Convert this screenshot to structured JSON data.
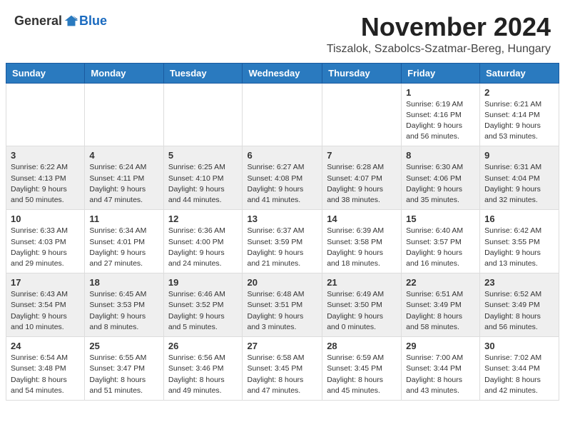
{
  "header": {
    "logo_general": "General",
    "logo_blue": "Blue",
    "month_title": "November 2024",
    "location": "Tiszalok, Szabolcs-Szatmar-Bereg, Hungary"
  },
  "days_of_week": [
    "Sunday",
    "Monday",
    "Tuesday",
    "Wednesday",
    "Thursday",
    "Friday",
    "Saturday"
  ],
  "weeks": [
    [
      {
        "day": "",
        "detail": ""
      },
      {
        "day": "",
        "detail": ""
      },
      {
        "day": "",
        "detail": ""
      },
      {
        "day": "",
        "detail": ""
      },
      {
        "day": "",
        "detail": ""
      },
      {
        "day": "1",
        "detail": "Sunrise: 6:19 AM\nSunset: 4:16 PM\nDaylight: 9 hours and 56 minutes."
      },
      {
        "day": "2",
        "detail": "Sunrise: 6:21 AM\nSunset: 4:14 PM\nDaylight: 9 hours and 53 minutes."
      }
    ],
    [
      {
        "day": "3",
        "detail": "Sunrise: 6:22 AM\nSunset: 4:13 PM\nDaylight: 9 hours and 50 minutes."
      },
      {
        "day": "4",
        "detail": "Sunrise: 6:24 AM\nSunset: 4:11 PM\nDaylight: 9 hours and 47 minutes."
      },
      {
        "day": "5",
        "detail": "Sunrise: 6:25 AM\nSunset: 4:10 PM\nDaylight: 9 hours and 44 minutes."
      },
      {
        "day": "6",
        "detail": "Sunrise: 6:27 AM\nSunset: 4:08 PM\nDaylight: 9 hours and 41 minutes."
      },
      {
        "day": "7",
        "detail": "Sunrise: 6:28 AM\nSunset: 4:07 PM\nDaylight: 9 hours and 38 minutes."
      },
      {
        "day": "8",
        "detail": "Sunrise: 6:30 AM\nSunset: 4:06 PM\nDaylight: 9 hours and 35 minutes."
      },
      {
        "day": "9",
        "detail": "Sunrise: 6:31 AM\nSunset: 4:04 PM\nDaylight: 9 hours and 32 minutes."
      }
    ],
    [
      {
        "day": "10",
        "detail": "Sunrise: 6:33 AM\nSunset: 4:03 PM\nDaylight: 9 hours and 29 minutes."
      },
      {
        "day": "11",
        "detail": "Sunrise: 6:34 AM\nSunset: 4:01 PM\nDaylight: 9 hours and 27 minutes."
      },
      {
        "day": "12",
        "detail": "Sunrise: 6:36 AM\nSunset: 4:00 PM\nDaylight: 9 hours and 24 minutes."
      },
      {
        "day": "13",
        "detail": "Sunrise: 6:37 AM\nSunset: 3:59 PM\nDaylight: 9 hours and 21 minutes."
      },
      {
        "day": "14",
        "detail": "Sunrise: 6:39 AM\nSunset: 3:58 PM\nDaylight: 9 hours and 18 minutes."
      },
      {
        "day": "15",
        "detail": "Sunrise: 6:40 AM\nSunset: 3:57 PM\nDaylight: 9 hours and 16 minutes."
      },
      {
        "day": "16",
        "detail": "Sunrise: 6:42 AM\nSunset: 3:55 PM\nDaylight: 9 hours and 13 minutes."
      }
    ],
    [
      {
        "day": "17",
        "detail": "Sunrise: 6:43 AM\nSunset: 3:54 PM\nDaylight: 9 hours and 10 minutes."
      },
      {
        "day": "18",
        "detail": "Sunrise: 6:45 AM\nSunset: 3:53 PM\nDaylight: 9 hours and 8 minutes."
      },
      {
        "day": "19",
        "detail": "Sunrise: 6:46 AM\nSunset: 3:52 PM\nDaylight: 9 hours and 5 minutes."
      },
      {
        "day": "20",
        "detail": "Sunrise: 6:48 AM\nSunset: 3:51 PM\nDaylight: 9 hours and 3 minutes."
      },
      {
        "day": "21",
        "detail": "Sunrise: 6:49 AM\nSunset: 3:50 PM\nDaylight: 9 hours and 0 minutes."
      },
      {
        "day": "22",
        "detail": "Sunrise: 6:51 AM\nSunset: 3:49 PM\nDaylight: 8 hours and 58 minutes."
      },
      {
        "day": "23",
        "detail": "Sunrise: 6:52 AM\nSunset: 3:49 PM\nDaylight: 8 hours and 56 minutes."
      }
    ],
    [
      {
        "day": "24",
        "detail": "Sunrise: 6:54 AM\nSunset: 3:48 PM\nDaylight: 8 hours and 54 minutes."
      },
      {
        "day": "25",
        "detail": "Sunrise: 6:55 AM\nSunset: 3:47 PM\nDaylight: 8 hours and 51 minutes."
      },
      {
        "day": "26",
        "detail": "Sunrise: 6:56 AM\nSunset: 3:46 PM\nDaylight: 8 hours and 49 minutes."
      },
      {
        "day": "27",
        "detail": "Sunrise: 6:58 AM\nSunset: 3:45 PM\nDaylight: 8 hours and 47 minutes."
      },
      {
        "day": "28",
        "detail": "Sunrise: 6:59 AM\nSunset: 3:45 PM\nDaylight: 8 hours and 45 minutes."
      },
      {
        "day": "29",
        "detail": "Sunrise: 7:00 AM\nSunset: 3:44 PM\nDaylight: 8 hours and 43 minutes."
      },
      {
        "day": "30",
        "detail": "Sunrise: 7:02 AM\nSunset: 3:44 PM\nDaylight: 8 hours and 42 minutes."
      }
    ]
  ]
}
